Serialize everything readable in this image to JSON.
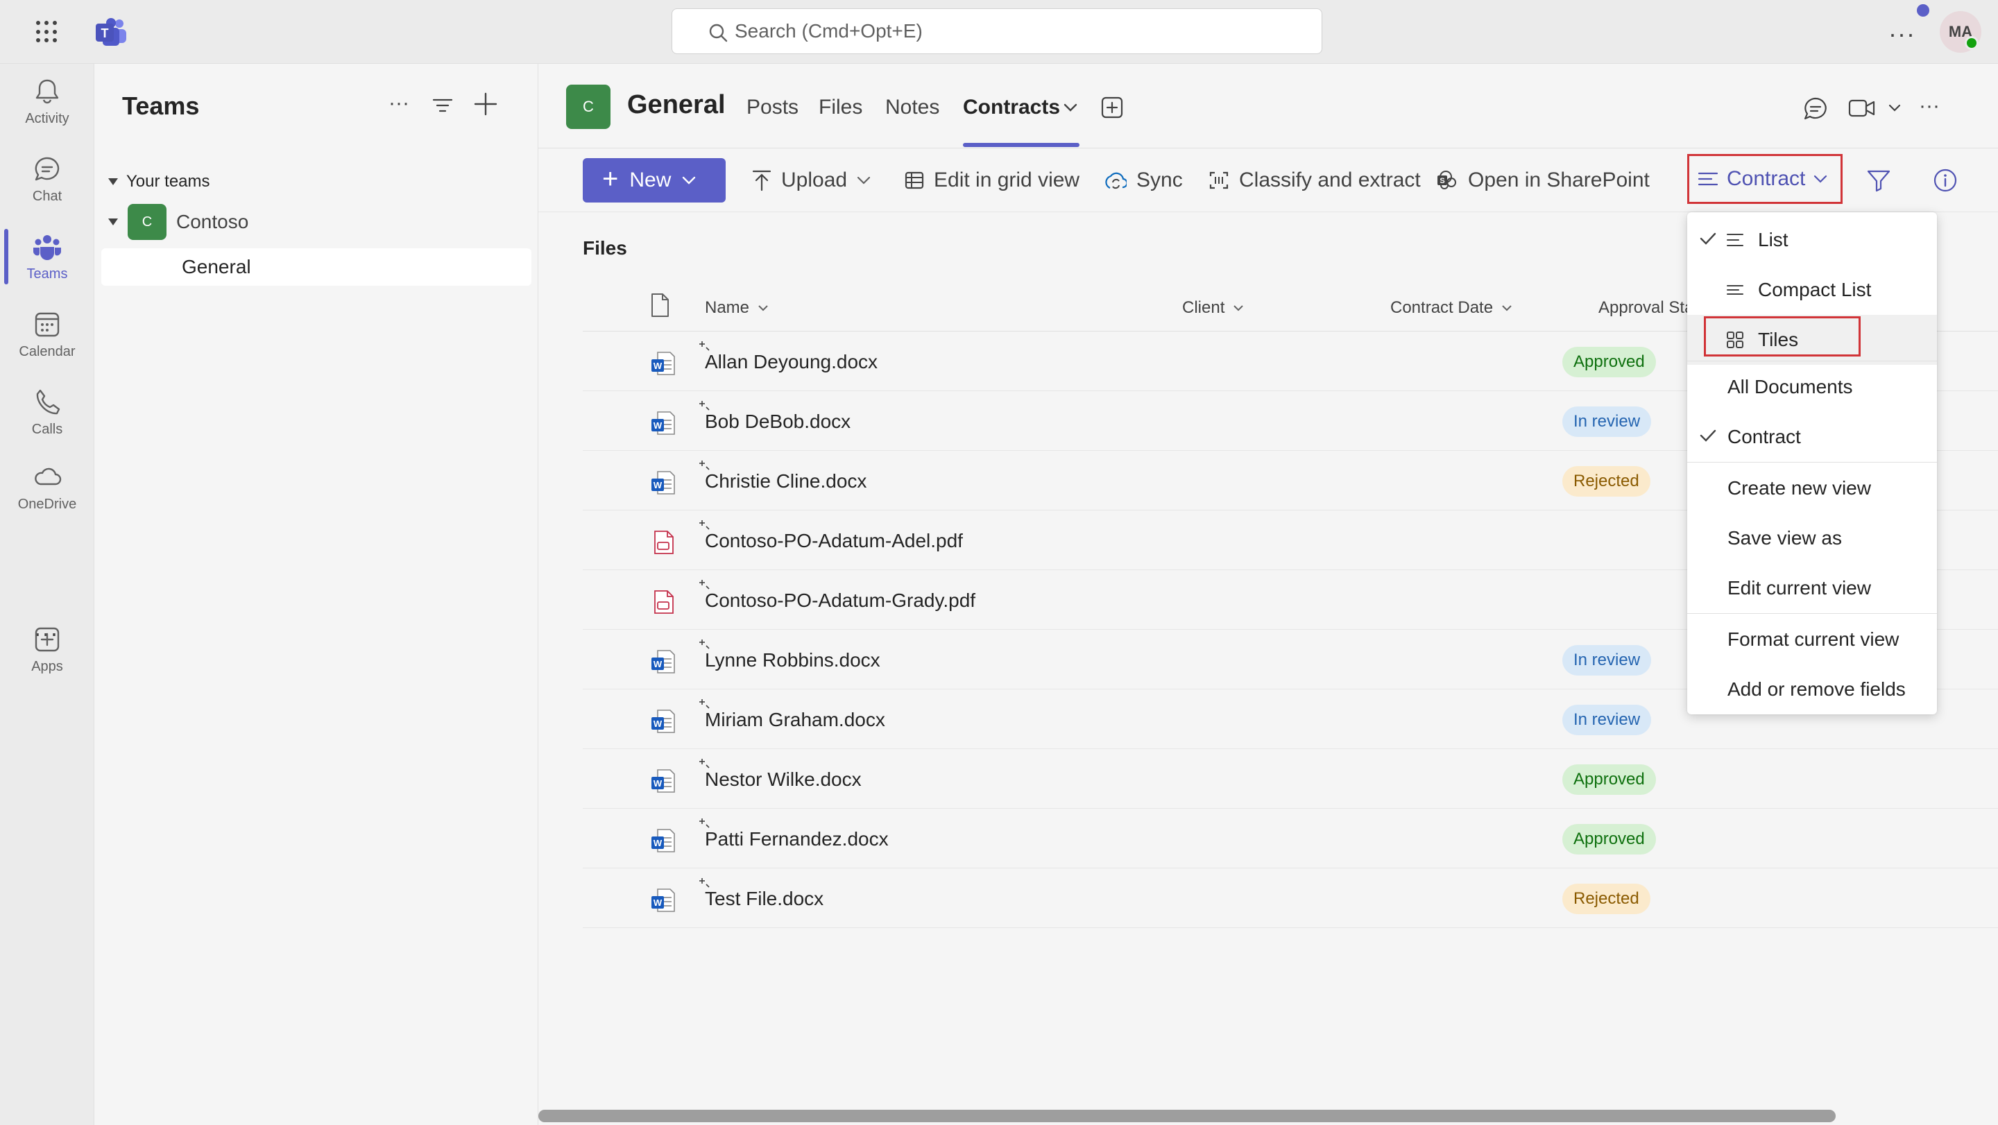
{
  "app": {
    "search": {
      "placeholder": "Search (Cmd+Opt+E)"
    },
    "user": {
      "initials": "MA"
    }
  },
  "rail": {
    "items": [
      {
        "label": "Activity",
        "icon": "bell-icon"
      },
      {
        "label": "Chat",
        "icon": "chat-icon"
      },
      {
        "label": "Teams",
        "icon": "teams-icon",
        "active": true
      },
      {
        "label": "Calendar",
        "icon": "calendar-icon"
      },
      {
        "label": "Calls",
        "icon": "phone-icon"
      },
      {
        "label": "OneDrive",
        "icon": "cloud-icon"
      },
      {
        "label": "Apps",
        "icon": "add-app-icon"
      }
    ]
  },
  "teams_pane": {
    "title": "Teams",
    "section_label": "Your teams",
    "team": {
      "badge": "C",
      "name": "Contoso"
    },
    "channel": "General"
  },
  "channel": {
    "badge": "C",
    "title": "General",
    "tabs": [
      "Posts",
      "Files",
      "Notes",
      "Contracts"
    ],
    "active_tab": "Contracts"
  },
  "command_bar": {
    "new_label": "New",
    "upload_label": "Upload",
    "grid_label": "Edit in grid view",
    "sync_label": "Sync",
    "classify_label": "Classify and extract",
    "sharepoint_label": "Open in SharePoint",
    "view_label": "Contract"
  },
  "files": {
    "title": "Files",
    "columns": [
      "Name",
      "Client",
      "Contract Date",
      "Approval Status"
    ],
    "rows": [
      {
        "name": "Allan Deyoung.docx",
        "type": "docx",
        "status": "Approved"
      },
      {
        "name": "Bob DeBob.docx",
        "type": "docx",
        "status": "In review"
      },
      {
        "name": "Christie Cline.docx",
        "type": "docx",
        "status": "Rejected"
      },
      {
        "name": "Contoso-PO-Adatum-Adel.pdf",
        "type": "pdf",
        "status": ""
      },
      {
        "name": "Contoso-PO-Adatum-Grady.pdf",
        "type": "pdf",
        "status": ""
      },
      {
        "name": "Lynne Robbins.docx",
        "type": "docx",
        "status": "In review"
      },
      {
        "name": "Miriam Graham.docx",
        "type": "docx",
        "status": "In review"
      },
      {
        "name": "Nestor Wilke.docx",
        "type": "docx",
        "status": "Approved"
      },
      {
        "name": "Patti Fernandez.docx",
        "type": "docx",
        "status": "Approved"
      },
      {
        "name": "Test File.docx",
        "type": "docx",
        "status": "Rejected"
      }
    ]
  },
  "view_menu": {
    "items": [
      "List",
      "Compact List",
      "Tiles",
      "All Documents",
      "Contract",
      "Create new view",
      "Save view as",
      "Edit current view",
      "Format current view",
      "Add or remove fields"
    ]
  },
  "colors": {
    "brand": "#5b5fc7",
    "highlight": "#d13438",
    "team_badge": "#3d8a49"
  }
}
